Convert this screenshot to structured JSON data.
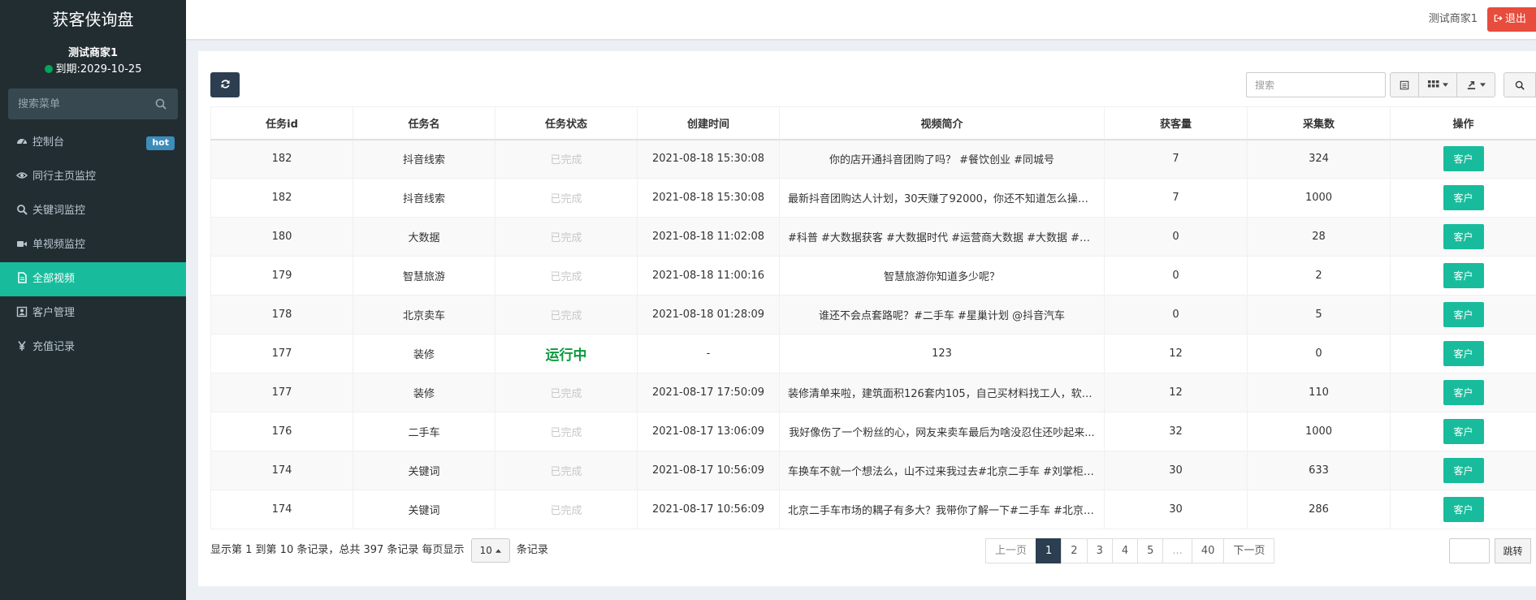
{
  "sidebar": {
    "brand": "获客侠询盘",
    "user_name": "测试商家1",
    "expire": "到期:2029-10-25",
    "search_placeholder": "搜索菜单",
    "items": [
      {
        "label": "控制台",
        "icon": "dashboard-icon",
        "badge": "hot"
      },
      {
        "label": "同行主页监控",
        "icon": "eye-icon"
      },
      {
        "label": "关键词监控",
        "icon": "search-icon"
      },
      {
        "label": "单视频监控",
        "icon": "video-camera-icon"
      },
      {
        "label": "全部视频",
        "icon": "file-icon",
        "active": true
      },
      {
        "label": "客户管理",
        "icon": "contact-card-icon"
      },
      {
        "label": "充值记录",
        "icon": "yen-icon"
      }
    ]
  },
  "header": {
    "user": "测试商家1",
    "logout_label": "退出"
  },
  "toolbar": {
    "search_placeholder": "搜索"
  },
  "table": {
    "columns": [
      "任务id",
      "任务名",
      "任务状态",
      "创建时间",
      "视频简介",
      "获客量",
      "采集数",
      "操作"
    ],
    "rows": [
      {
        "id": "182",
        "name": "抖音线索",
        "status": "已完成",
        "created": "2021-08-18 15:30:08",
        "desc": "你的店开通抖音团购了吗？ #餐饮创业 #同城号",
        "leads": "7",
        "collected": "324",
        "action": "客户"
      },
      {
        "id": "182",
        "name": "抖音线索",
        "status": "已完成",
        "created": "2021-08-18 15:30:08",
        "desc": "最新抖音团购达人计划，30天赚了92000，你还不知道怎么操作...",
        "leads": "7",
        "collected": "1000",
        "action": "客户"
      },
      {
        "id": "180",
        "name": "大数据",
        "status": "已完成",
        "created": "2021-08-18 11:02:08",
        "desc": "#科普 #大数据获客 #大数据时代 #运营商大数据 #大数据 #运营...",
        "leads": "0",
        "collected": "28",
        "action": "客户"
      },
      {
        "id": "179",
        "name": "智慧旅游",
        "status": "已完成",
        "created": "2021-08-18 11:00:16",
        "desc": "智慧旅游你知道多少呢？",
        "leads": "0",
        "collected": "2",
        "action": "客户"
      },
      {
        "id": "178",
        "name": "北京卖车",
        "status": "已完成",
        "created": "2021-08-18 01:28:09",
        "desc": "谁还不会点套路呢？#二手车 #星巢计划 @抖音汽车",
        "leads": "0",
        "collected": "5",
        "action": "客户"
      },
      {
        "id": "177",
        "name": "装修",
        "status": "运行中",
        "created": "-",
        "desc": "123",
        "leads": "12",
        "collected": "0",
        "action": "客户"
      },
      {
        "id": "177",
        "name": "装修",
        "status": "已完成",
        "created": "2021-08-17 17:50:09",
        "desc": "装修清单来啦，建筑面积126套内105，自己买材料找工人，软装...",
        "leads": "12",
        "collected": "110",
        "action": "客户"
      },
      {
        "id": "176",
        "name": "二手车",
        "status": "已完成",
        "created": "2021-08-17 13:06:09",
        "desc": "我好像伤了一个粉丝的心，网友来卖车最后为啥没忍住还吵起来...",
        "leads": "32",
        "collected": "1000",
        "action": "客户"
      },
      {
        "id": "174",
        "name": "关键词",
        "status": "已完成",
        "created": "2021-08-17 10:56:09",
        "desc": "车换车不就一个想法么，山不过来我过去#北京二手车 #刘掌柜 #...",
        "leads": "30",
        "collected": "633",
        "action": "客户"
      },
      {
        "id": "174",
        "name": "关键词",
        "status": "已完成",
        "created": "2021-08-17 10:56:09",
        "desc": "北京二手车市场的耦子有多大？我带你了解一下#二手车 #北京 #...",
        "leads": "30",
        "collected": "286",
        "action": "客户"
      }
    ]
  },
  "pagination": {
    "info_prefix": "显示第 1 到第 10 条记录，总共 397 条记录 每页显示",
    "page_size": "10",
    "info_suffix": "条记录",
    "prev": "上一页",
    "pages": [
      "1",
      "2",
      "3",
      "4",
      "5",
      "...",
      "40"
    ],
    "current": "1",
    "next": "下一页",
    "jump_label": "跳转"
  },
  "colors": {
    "sidebar_bg": "#222d32",
    "accent": "#18bc9c",
    "logout": "#e74c3c",
    "dark_button": "#2c3e50",
    "hot_badge": "#3c8dbc",
    "running": "#0a9a3f"
  }
}
